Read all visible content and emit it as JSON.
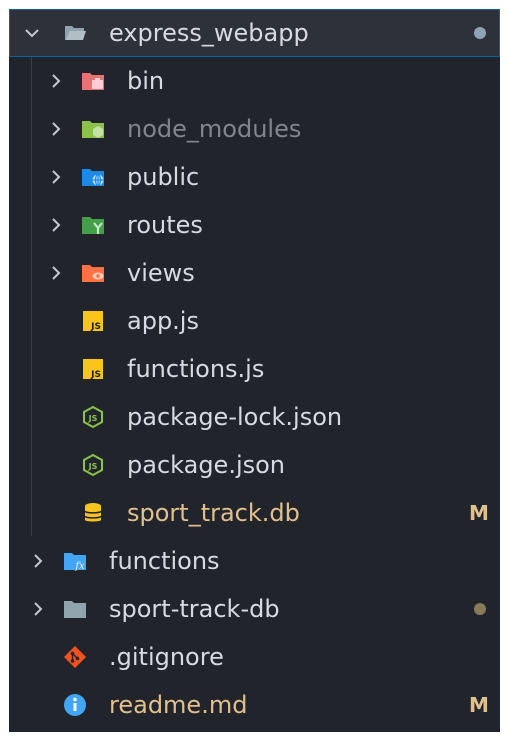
{
  "colors": {
    "panel_bg": "#21252b",
    "selection_bg": "#2c313a",
    "selection_border": "#0e639c",
    "text": "#d7dae0",
    "text_dim": "#80858e",
    "modified": "#e2c08d",
    "dot_root": "#8fa3b5",
    "dot_folder": "#8a7a5a"
  },
  "tree": {
    "root": {
      "label": "express_webapp",
      "icon": "folder-open-icon"
    },
    "children": [
      {
        "label": "bin",
        "icon": "folder-bin-icon"
      },
      {
        "label": "node_modules",
        "icon": "folder-node-icon"
      },
      {
        "label": "public",
        "icon": "folder-public-icon"
      },
      {
        "label": "routes",
        "icon": "folder-routes-icon"
      },
      {
        "label": "views",
        "icon": "folder-views-icon"
      },
      {
        "label": "app.js",
        "icon": "js-file-icon"
      },
      {
        "label": "functions.js",
        "icon": "js-file-icon"
      },
      {
        "label": "package-lock.json",
        "icon": "nodejs-file-icon"
      },
      {
        "label": "package.json",
        "icon": "nodejs-file-icon"
      },
      {
        "label": "sport_track.db",
        "icon": "database-icon",
        "badge": "M"
      }
    ],
    "siblings": [
      {
        "label": "functions",
        "icon": "folder-functions-icon"
      },
      {
        "label": "sport-track-db",
        "icon": "folder-icon"
      },
      {
        "label": ".gitignore",
        "icon": "git-icon"
      },
      {
        "label": "readme.md",
        "icon": "info-icon",
        "badge": "M"
      }
    ]
  }
}
